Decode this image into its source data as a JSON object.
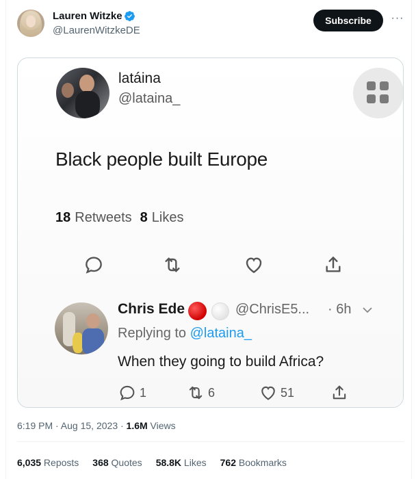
{
  "tweet": {
    "author_name": "Lauren Witzke",
    "author_handle": "@LaurenWitzkeDE",
    "subscribe_label": "Subscribe",
    "more_label": "···",
    "timestamp": "6:19 PM · Aug 15, 2023 · ",
    "views_count": "1.6M",
    "views_label": " Views",
    "stats": [
      {
        "count": "6,035",
        "label": " Reposts"
      },
      {
        "count": "368",
        "label": " Quotes"
      },
      {
        "count": "58.8K",
        "label": " Likes"
      },
      {
        "count": "762",
        "label": " Bookmarks"
      }
    ],
    "verified_color": "#1d9bf0"
  },
  "embedded": {
    "original": {
      "name": "latáina",
      "handle": "@lataina_",
      "text": "Black people built Europe",
      "retweets_count": "18",
      "retweets_label": "Retweets",
      "likes_count": "8",
      "likes_label": "Likes",
      "actions": [
        "reply-icon",
        "retweet-icon",
        "like-icon",
        "share-icon"
      ]
    },
    "reply": {
      "name": "Chris Ede",
      "handle": "@ChrisE5...",
      "time": "· 6h",
      "replying_prefix": "Replying to ",
      "replying_mention": "@lataina_",
      "text": "When they going to build Africa?",
      "reply_count": "1",
      "retweet_count": "6",
      "like_count": "51"
    }
  }
}
